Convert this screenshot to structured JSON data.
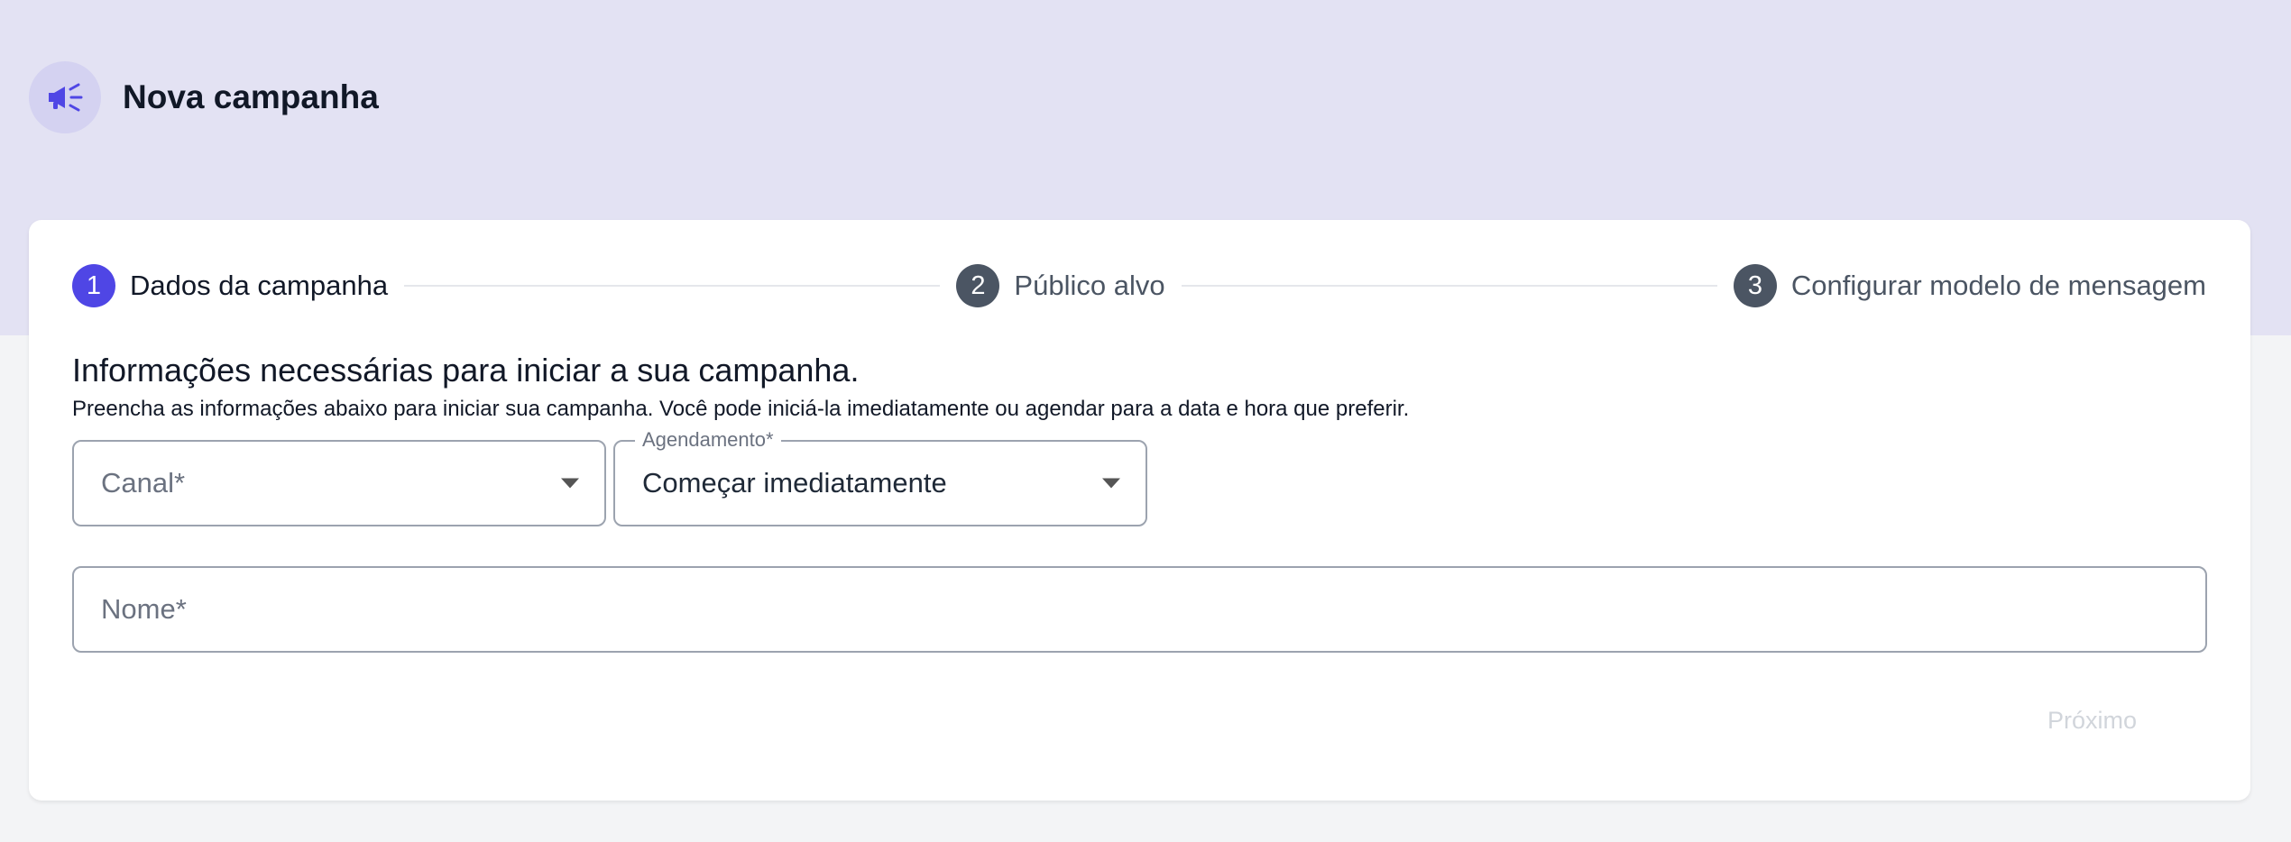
{
  "header": {
    "title": "Nova campanha",
    "icon": "megaphone-icon"
  },
  "stepper": {
    "steps": [
      {
        "number": "1",
        "label": "Dados da campanha",
        "state": "active"
      },
      {
        "number": "2",
        "label": "Público alvo",
        "state": "inactive"
      },
      {
        "number": "3",
        "label": "Configurar modelo de mensagem",
        "state": "inactive"
      }
    ]
  },
  "form": {
    "title": "Informações necessárias para iniciar a sua campanha.",
    "description": "Preencha as informações abaixo para iniciar sua campanha. Você pode iniciá-la imediatamente ou agendar para a data e hora que preferir.",
    "canal": {
      "placeholder": "Canal*",
      "value": ""
    },
    "agendamento": {
      "label": "Agendamento*",
      "value": "Começar imediatamente"
    },
    "nome": {
      "placeholder": "Nome*",
      "value": ""
    },
    "next_label": "Próximo"
  },
  "colors": {
    "accent": "#4f46e5",
    "header_band": "#e3e2f3",
    "icon_bg": "#d4d2f1",
    "step_inactive": "#4b5563",
    "button_disabled": "#d1d5db"
  }
}
